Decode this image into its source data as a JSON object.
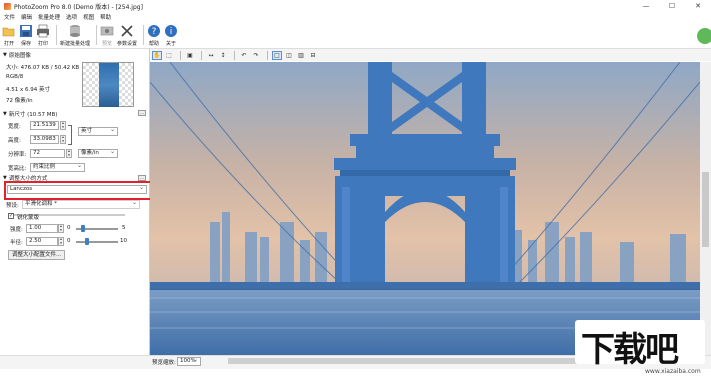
{
  "window": {
    "title": "PhotoZoom Pro 8.0 (Demo 版本) - [254.jpg]"
  },
  "menu": [
    "文件",
    "编辑",
    "批量处理",
    "选项",
    "视图",
    "帮助"
  ],
  "toolbar": {
    "items": [
      {
        "label": "打开",
        "icon": "folder-open-icon"
      },
      {
        "label": "保存",
        "icon": "save-icon"
      },
      {
        "label": "打印",
        "icon": "print-icon"
      },
      {
        "label": "新建批量处理",
        "icon": "batch-icon"
      },
      {
        "label": "预览",
        "icon": "preview-icon"
      },
      {
        "label": "参数设置",
        "icon": "settings-icon"
      },
      {
        "label": "帮助",
        "icon": "help-icon"
      },
      {
        "label": "关于",
        "icon": "info-icon"
      }
    ]
  },
  "left_panel": {
    "original": {
      "heading": "原始图像",
      "size": "大小: 476.07 KB / 50.42 KB",
      "mode": "RGB/8",
      "dimensions": "4.51 x 6.94 英寸",
      "resolution": "72 像素/in"
    },
    "new_size": {
      "heading": "新尺寸 (10.57 MB)",
      "width_label": "宽度:",
      "width_value": "21.5139",
      "height_label": "高度:",
      "height_value": "33.0983",
      "dim_unit": "英寸",
      "res_label": "分辨率:",
      "res_value": "72",
      "res_unit": "像素/in",
      "aspect_label": "宽高比:",
      "aspect_value": "约束比例"
    },
    "resize_method": {
      "heading": "调整大小的方式",
      "method_value": "Lanczos",
      "preset_label": "预设:",
      "preset_value": "平滑化调和 *",
      "unsharp_label": "锐化蒙版",
      "strength_label": "强度:",
      "strength_value": "1.00",
      "strength_min": "0",
      "strength_max": "5",
      "radius_label": "半径:",
      "radius_value": "2.50",
      "radius_min": "0",
      "radius_max": "10",
      "profile_button": "调整大小配置文件..."
    }
  },
  "status": {
    "preview_zoom_label": "预览缩放:",
    "zoom_value": "100%"
  },
  "watermark": {
    "text": "下载吧",
    "url": "www.xiazaiba.com"
  },
  "colors": {
    "highlight": "#e2222b",
    "sky": "#d9b49a",
    "structure": "#3e7ec5"
  }
}
